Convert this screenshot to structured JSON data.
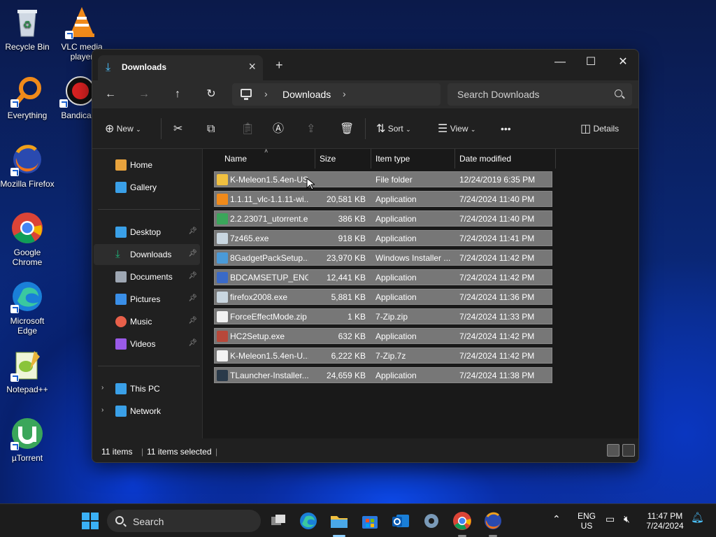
{
  "desktop": {
    "icons": [
      {
        "label": "Recycle Bin",
        "icon": "recycle-bin-icon"
      },
      {
        "label": "VLC media player",
        "icon": "vlc-icon"
      },
      {
        "label": "Everything",
        "icon": "everything-icon"
      },
      {
        "label": "Bandica",
        "icon": "bandicam-icon"
      },
      {
        "label": "Mozilla Firefox",
        "icon": "firefox-icon"
      },
      {
        "label": "Google Chrome",
        "icon": "chrome-icon"
      },
      {
        "label": "Microsoft Edge",
        "icon": "edge-icon"
      },
      {
        "label": "Notepad++",
        "icon": "notepadpp-icon"
      },
      {
        "label": "µTorrent",
        "icon": "utorrent-icon"
      }
    ]
  },
  "window": {
    "tab_title": "Downloads",
    "new_tab": "+",
    "controls": {
      "minimize": "—",
      "maximize": "☐",
      "close": "✕"
    }
  },
  "address": {
    "crumb": "Downloads"
  },
  "search": {
    "placeholder": "Search Downloads"
  },
  "toolbar": {
    "new_label": "New",
    "sort_label": "Sort",
    "view_label": "View",
    "more_label": "•••",
    "details_label": "Details"
  },
  "sidebar": {
    "items": [
      {
        "label": "Home",
        "icon": "home-icon",
        "color": "#e8a33d"
      },
      {
        "label": "Gallery",
        "icon": "gallery-icon",
        "color": "#3aa0e8"
      },
      {
        "label": "Desktop",
        "icon": "desktop-icon",
        "color": "#3aa0e8"
      },
      {
        "label": "Downloads",
        "icon": "downloads-icon",
        "color": "#1fb57a"
      },
      {
        "label": "Documents",
        "icon": "documents-icon",
        "color": "#9ea7b3"
      },
      {
        "label": "Pictures",
        "icon": "pictures-icon",
        "color": "#3a8fe8"
      },
      {
        "label": "Music",
        "icon": "music-icon",
        "color": "#e8604a"
      },
      {
        "label": "Videos",
        "icon": "videos-icon",
        "color": "#9a5ae8"
      },
      {
        "label": "This PC",
        "icon": "this-pc-icon",
        "color": "#3aa0e8"
      },
      {
        "label": "Network",
        "icon": "network-icon",
        "color": "#3aa0e8"
      }
    ]
  },
  "columns": {
    "name": "Name",
    "size": "Size",
    "type": "Item type",
    "date": "Date modified"
  },
  "files": [
    {
      "name": "K-Meleon1.5.4en-US",
      "size": "",
      "type": "File folder",
      "date": "12/24/2019 6:35 PM",
      "color": "#f0c040"
    },
    {
      "name": "1.1.11_vlc-1.1.11-wi...",
      "size": "20,581 KB",
      "type": "Application",
      "date": "7/24/2024 11:40 PM",
      "color": "#f08a1a"
    },
    {
      "name": "2.2.23071_utorrent.e...",
      "size": "386 KB",
      "type": "Application",
      "date": "7/24/2024 11:40 PM",
      "color": "#3aa65a"
    },
    {
      "name": "7z465.exe",
      "size": "918 KB",
      "type": "Application",
      "date": "7/24/2024 11:41 PM",
      "color": "#c9d6e0"
    },
    {
      "name": "8GadgetPackSetup....",
      "size": "23,970 KB",
      "type": "Windows Installer ...",
      "date": "7/24/2024 11:42 PM",
      "color": "#4a9ad8"
    },
    {
      "name": "BDCAMSETUP_ENG...",
      "size": "12,441 KB",
      "type": "Application",
      "date": "7/24/2024 11:42 PM",
      "color": "#3a6ac8"
    },
    {
      "name": "firefox2008.exe",
      "size": "5,881 KB",
      "type": "Application",
      "date": "7/24/2024 11:36 PM",
      "color": "#c9d6e0"
    },
    {
      "name": "ForceEffectMode.zip",
      "size": "1 KB",
      "type": "7-Zip.zip",
      "date": "7/24/2024 11:33 PM",
      "color": "#f2f2f2"
    },
    {
      "name": "HC2Setup.exe",
      "size": "632 KB",
      "type": "Application",
      "date": "7/24/2024 11:42 PM",
      "color": "#b8483a"
    },
    {
      "name": "K-Meleon1.5.4en-U...",
      "size": "6,222 KB",
      "type": "7-Zip.7z",
      "date": "7/24/2024 11:42 PM",
      "color": "#f2f2f2"
    },
    {
      "name": "TLauncher-Installer...",
      "size": "24,659 KB",
      "type": "Application",
      "date": "7/24/2024 11:38 PM",
      "color": "#2a3a4a"
    }
  ],
  "status": {
    "count": "11 items",
    "selected": "11 items selected"
  },
  "taskbar": {
    "search_placeholder": "Search",
    "lang_line1": "ENG",
    "lang_line2": "US",
    "time": "11:47 PM",
    "date": "7/24/2024"
  }
}
